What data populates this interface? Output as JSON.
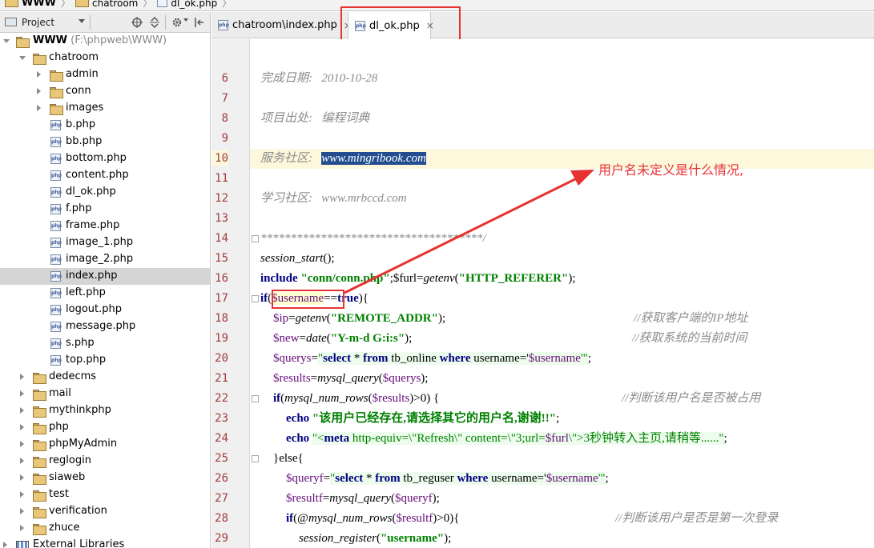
{
  "breadcrumb": {
    "root": "WWW",
    "folder": "chatroom",
    "file": "dl_ok.php"
  },
  "project_panel": {
    "selector_label": "Project",
    "root_label": "WWW",
    "root_path": "(F:\\phpweb\\WWW)",
    "items": [
      {
        "label": "chatroom",
        "type": "folder",
        "expanded": true
      },
      {
        "label": "admin",
        "type": "folder"
      },
      {
        "label": "conn",
        "type": "folder"
      },
      {
        "label": "images",
        "type": "folder"
      },
      {
        "label": "b.php",
        "type": "php"
      },
      {
        "label": "bb.php",
        "type": "php"
      },
      {
        "label": "bottom.php",
        "type": "php"
      },
      {
        "label": "content.php",
        "type": "php"
      },
      {
        "label": "dl_ok.php",
        "type": "php"
      },
      {
        "label": "f.php",
        "type": "php"
      },
      {
        "label": "frame.php",
        "type": "php"
      },
      {
        "label": "image_1.php",
        "type": "php"
      },
      {
        "label": "image_2.php",
        "type": "php"
      },
      {
        "label": "index.php",
        "type": "php",
        "selected": true
      },
      {
        "label": "left.php",
        "type": "php"
      },
      {
        "label": "logout.php",
        "type": "php"
      },
      {
        "label": "message.php",
        "type": "php"
      },
      {
        "label": "s.php",
        "type": "php"
      },
      {
        "label": "top.php",
        "type": "php"
      },
      {
        "label": "dedecms",
        "type": "folder"
      },
      {
        "label": "mail",
        "type": "folder"
      },
      {
        "label": "mythinkphp",
        "type": "folder"
      },
      {
        "label": "php",
        "type": "folder"
      },
      {
        "label": "phpMyAdmin",
        "type": "folder"
      },
      {
        "label": "reglogin",
        "type": "folder"
      },
      {
        "label": "siaweb",
        "type": "folder"
      },
      {
        "label": "test",
        "type": "folder"
      },
      {
        "label": "verification",
        "type": "folder"
      },
      {
        "label": "zhuce",
        "type": "folder"
      },
      {
        "label": "External Libraries",
        "type": "library"
      }
    ]
  },
  "tabs": [
    {
      "label": "chatroom\\index.php",
      "close": "×"
    },
    {
      "label": "dl_ok.php",
      "close": "×",
      "active": true
    }
  ],
  "editor": {
    "current_line": 10,
    "lines": [
      {
        "n": "6"
      },
      {
        "n": "7"
      },
      {
        "n": "8"
      },
      {
        "n": "9"
      },
      {
        "n": "10"
      },
      {
        "n": "11"
      },
      {
        "n": "12"
      },
      {
        "n": "13"
      },
      {
        "n": "14"
      },
      {
        "n": "15"
      },
      {
        "n": "16"
      },
      {
        "n": "17"
      },
      {
        "n": "18"
      },
      {
        "n": "19"
      },
      {
        "n": "20"
      },
      {
        "n": "21"
      },
      {
        "n": "22"
      },
      {
        "n": "23"
      },
      {
        "n": "24"
      },
      {
        "n": "25"
      },
      {
        "n": "26"
      },
      {
        "n": "27"
      },
      {
        "n": "28"
      },
      {
        "n": "29"
      }
    ],
    "code": {
      "l6_label": "完成日期:",
      "l6_value": "2010-10-28",
      "l8_label": "项目出处:",
      "l8_value": "编程词典",
      "l10_label": "服务社区:",
      "l10_value": "www.mingribook.com",
      "l12_label": "学习社区:",
      "l12_value": "www.mrbccd.com",
      "l14": "*************************************/",
      "l15_fn": "session_start",
      "l15_rest": "();",
      "l16_kw": "include",
      "l16_str": "\"conn/conn.php\"",
      "l16_mid": ";$furl=",
      "l16_fn": "getenv",
      "l16_arg": "\"HTTP_REFERER\"",
      "l16_end": ");",
      "l17_kw": "if",
      "l17_p": "(",
      "l17_var": "$username",
      "l17_op": "==",
      "l17_true": "true",
      "l17_end": "){",
      "l18_var": "$ip",
      "l18_eq": "=",
      "l18_fn": "getenv",
      "l18_arg": "\"REMOTE_ADDR\"",
      "l18_end": ");",
      "l18_cmt": "//获取客户端的IP地址",
      "l19_var": "$new",
      "l19_eq": "=",
      "l19_fn": "date",
      "l19_arg": "\"Y-m-d G:i:s\"",
      "l19_end": ");",
      "l19_cmt": "//获取系统的当前时间",
      "l20_var": "$querys",
      "l20_eq": "=",
      "l20_q": "\"",
      "l20_sql1": "select",
      "l20_sql2": " * ",
      "l20_sql3": "from",
      "l20_sql4": " tb_online ",
      "l20_sql5": "where",
      "l20_sql6": " username='",
      "l20_var2": "$username",
      "l20_tail": "'\"",
      "l20_end": ";",
      "l21_var": "$results",
      "l21_eq": "=",
      "l21_fn": "mysql_query",
      "l21_p": "(",
      "l21_var2": "$querys",
      "l21_end": ");",
      "l22_kw": "if",
      "l22_p": "(",
      "l22_fn": "mysql_num_rows",
      "l22_p2": "(",
      "l22_var": "$results",
      "l22_end": ")>0) {",
      "l22_cmt": "//判断该用户名是否被占用",
      "l23_kw": "echo",
      "l23_str": "\"该用户已经存在,请选择其它的用户名,谢谢!!\"",
      "l23_end": ";",
      "l24_kw": "echo",
      "l24_s1": "\"<",
      "l24_s2": "meta",
      "l24_s3": " http-equiv=\\\"Refresh\\\" content=\\\"3;url=",
      "l24_var": "$furl",
      "l24_s4": "\\\">3秒钟转入主页,请稍等......\"",
      "l24_end": ";",
      "l25": "}else{",
      "l26_var": "$queryf",
      "l26_eq": "=",
      "l26_q": "\"",
      "l26_sql1": "select",
      "l26_sql2": " * ",
      "l26_sql3": "from",
      "l26_sql4": " tb_reguser ",
      "l26_sql5": "where",
      "l26_sql6": " username='",
      "l26_var2": "$username",
      "l26_tail": "'\"",
      "l26_end": ";",
      "l27_var": "$resultf",
      "l27_eq": "=",
      "l27_fn": "mysql_query",
      "l27_p": "(",
      "l27_var2": "$queryf",
      "l27_end": ");",
      "l28_kw": "if",
      "l28_p": "(@",
      "l28_fn": "mysql_num_rows",
      "l28_p2": "(",
      "l28_var": "$resultf",
      "l28_end": ")>0){",
      "l28_cmt": "//判断该用户是否是第一次登录",
      "l29_fn": "session_register",
      "l29_p": "(",
      "l29_str": "\"username\"",
      "l29_end": ");"
    }
  },
  "annotation": {
    "text": "用户名未定义是什么情况,",
    "color": "#e83232"
  },
  "colors": {
    "keyword": "#000080",
    "string": "#008000",
    "variable": "#660e7a",
    "comment": "#8c8c8c",
    "line_number": "#a23a3a",
    "annotation": "#e83232",
    "selection": "#234d90"
  },
  "icons": [
    "folder-icon",
    "php-file-icon",
    "target-icon",
    "collapse-icon",
    "gear-icon",
    "hide-panel-icon",
    "close-icon"
  ]
}
